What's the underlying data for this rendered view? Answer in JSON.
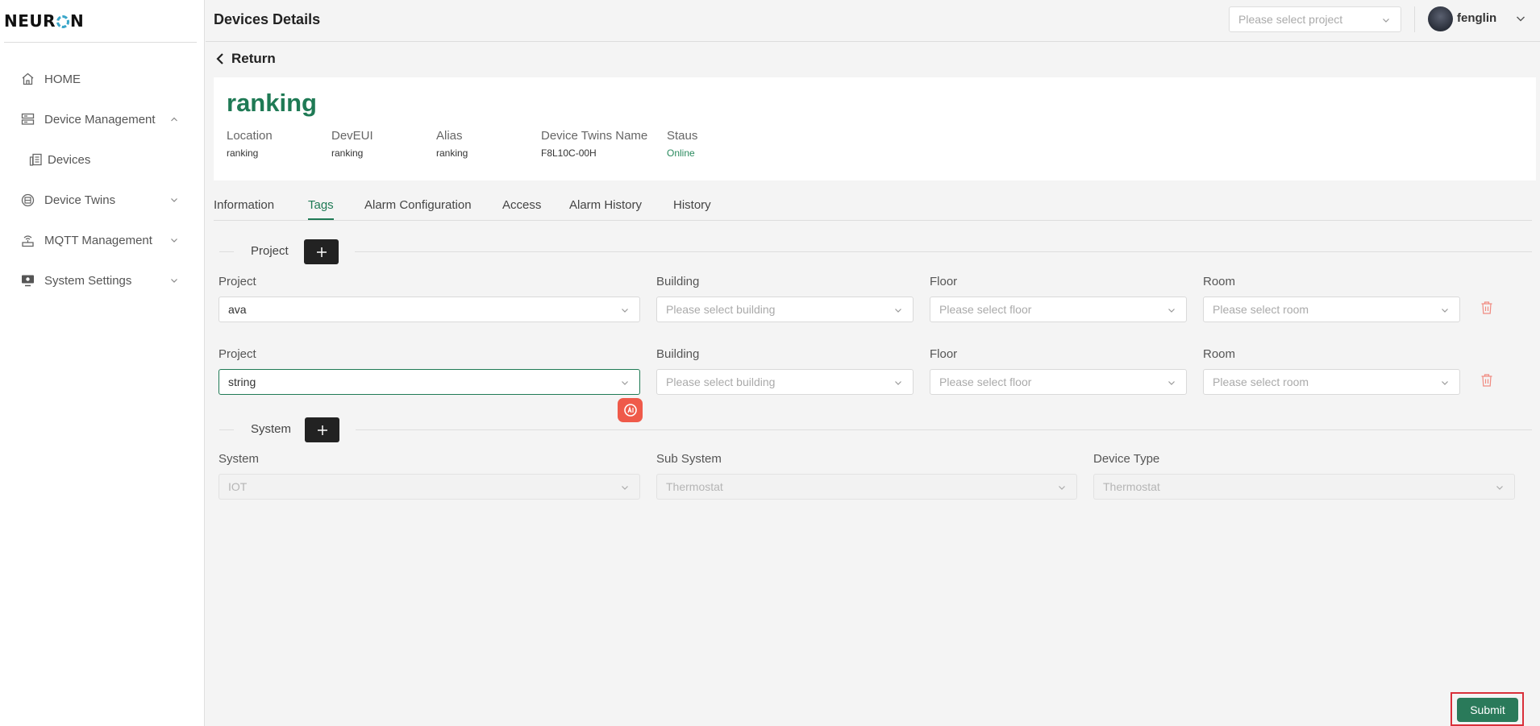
{
  "app": {
    "logo_text_a": "NEUR",
    "logo_text_b": "N"
  },
  "sidebar": {
    "items": [
      {
        "label": "HOME",
        "icon": "home-icon"
      },
      {
        "label": "Device Management",
        "icon": "server-icon",
        "expanded": true
      },
      {
        "label": "Devices",
        "icon": "devices-icon",
        "sub": true
      },
      {
        "label": "Device Twins",
        "icon": "twins-icon"
      },
      {
        "label": "MQTT Management",
        "icon": "antenna-icon"
      },
      {
        "label": "System Settings",
        "icon": "monitor-icon"
      }
    ]
  },
  "header": {
    "title": "Devices Details",
    "project_placeholder": "Please select project",
    "username": "fenglin"
  },
  "return_label": "Return",
  "device": {
    "name": "ranking",
    "meta": [
      {
        "label": "Location",
        "value": "ranking"
      },
      {
        "label": "DevEUI",
        "value": "ranking"
      },
      {
        "label": "Alias",
        "value": "ranking"
      },
      {
        "label": "Device Twins Name",
        "value": "F8L10C-00H"
      },
      {
        "label": "Staus",
        "value": "Online"
      }
    ]
  },
  "tabs": [
    "Information",
    "Tags",
    "Alarm Configuration",
    "Access",
    "Alarm History",
    "History"
  ],
  "active_tab": "Tags",
  "project_section": {
    "title": "Project",
    "rows": [
      {
        "project_label": "Project",
        "project_value": "ava",
        "building_label": "Building",
        "building_placeholder": "Please select building",
        "floor_label": "Floor",
        "floor_placeholder": "Please select floor",
        "room_label": "Room",
        "room_placeholder": "Please select room"
      },
      {
        "project_label": "Project",
        "project_value": "string",
        "building_label": "Building",
        "building_placeholder": "Please select building",
        "floor_label": "Floor",
        "floor_placeholder": "Please select floor",
        "room_label": "Room",
        "room_placeholder": "Please select room"
      }
    ]
  },
  "system_section": {
    "title": "System",
    "system_label": "System",
    "system_value": "IOT",
    "subsystem_label": "Sub System",
    "subsystem_value": "Thermostat",
    "device_type_label": "Device Type",
    "device_type_value": "Thermostat"
  },
  "submit_label": "Submit",
  "colors": {
    "accent": "#1f7a55",
    "submit": "#2a7a5a",
    "danger": "#ef5a4a",
    "highlight": "#d9303a"
  }
}
